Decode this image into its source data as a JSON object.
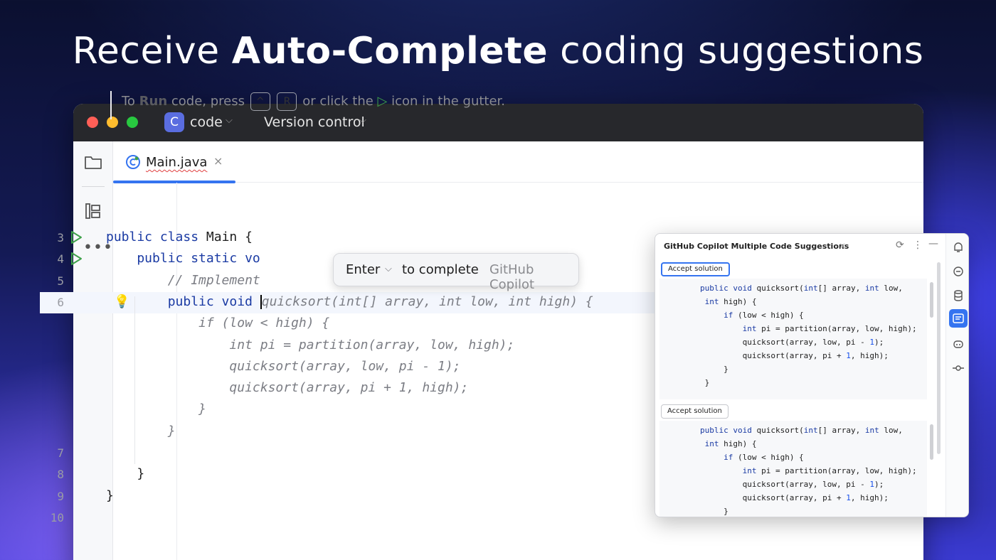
{
  "headline": {
    "pre": "Receive ",
    "bold": "Auto-Complete",
    "post": " coding suggestions"
  },
  "titlebar": {
    "project_badge": "C",
    "project_name": "code",
    "vcs_label": "Version control"
  },
  "sidebar": {
    "more": "•••"
  },
  "tab": {
    "label": "Main.java",
    "close": "×"
  },
  "hint": {
    "pre": "To ",
    "run_word": "Run",
    "mid": " code, press ",
    "key1": "^",
    "key2": "R",
    "post": " or click the ",
    "play": "▷",
    "tail": " icon in the gutter."
  },
  "editor": {
    "lines": [
      {
        "num": "3",
        "run": true,
        "segments": [
          {
            "t": "public class ",
            "c": "kw"
          },
          {
            "t": "Main {",
            "c": ""
          }
        ]
      },
      {
        "num": "4",
        "run": true,
        "segments": [
          {
            "t": "    public static ",
            "c": "kw"
          },
          {
            "t": "vo",
            "c": "kw"
          }
        ]
      },
      {
        "num": "5",
        "segments": [
          {
            "t": "        // Implement",
            "c": "sugg"
          }
        ]
      },
      {
        "num": "6",
        "current": true,
        "segments": [
          {
            "t": "        public void ",
            "c": "kw"
          }
        ],
        "suggestion": "quicksort(int[] array, int low, int high) {"
      },
      {
        "num": "",
        "segments": [
          {
            "t": "            if (low < high) {",
            "c": "sugg"
          }
        ]
      },
      {
        "num": "",
        "segments": [
          {
            "t": "                int pi = partition(array, low, high);",
            "c": "sugg"
          }
        ]
      },
      {
        "num": "",
        "segments": [
          {
            "t": "                quicksort(array, low, pi - 1);",
            "c": "sugg"
          }
        ]
      },
      {
        "num": "",
        "segments": [
          {
            "t": "                quicksort(array, pi + 1, high);",
            "c": "sugg"
          }
        ]
      },
      {
        "num": "",
        "segments": [
          {
            "t": "            }",
            "c": "sugg"
          }
        ]
      },
      {
        "num": "",
        "segments": [
          {
            "t": "        }",
            "c": "sugg"
          }
        ]
      },
      {
        "num": "7",
        "segments": [
          {
            "t": "",
            "c": ""
          }
        ]
      },
      {
        "num": "8",
        "segments": [
          {
            "t": "    }",
            "c": ""
          }
        ]
      },
      {
        "num": "9",
        "segments": [
          {
            "t": "}",
            "c": ""
          }
        ]
      },
      {
        "num": "10",
        "segments": [
          {
            "t": "",
            "c": ""
          }
        ]
      }
    ]
  },
  "completion": {
    "key": "Enter",
    "action": "to complete",
    "source": "GitHub Copilot"
  },
  "copilot": {
    "title": "GitHub Copilot Multiple Code Suggestions",
    "close": "×",
    "solutions": [
      {
        "accept_label": "Accept solution",
        "focused": true,
        "code": [
          "        public void quicksort(int[] array, int low,",
          "         int high) {",
          "             if (low < high) {",
          "                 int pi = partition(array, low, high);",
          "                 quicksort(array, low, pi - 1);",
          "                 quicksort(array, pi + 1, high);",
          "             }",
          "         }"
        ]
      },
      {
        "accept_label": "Accept solution",
        "focused": false,
        "code": [
          "        public void quicksort(int[] array, int low,",
          "         int high) {",
          "             if (low < high) {",
          "                 int pi = partition(array, low, high);",
          "                 quicksort(array, low, pi - 1);",
          "                 quicksort(array, pi + 1, high);",
          "             }"
        ]
      }
    ]
  },
  "colors": {
    "accent": "#3574f0",
    "keyword": "#1a3aa3",
    "suggestion": "#7b7d84",
    "run_green": "#3fa14a"
  },
  "icons": {
    "sidebar": [
      "folder-icon",
      "structure-icon",
      "more-icon"
    ],
    "rail": [
      "notifications-icon",
      "copilot-chat-icon",
      "database-icon",
      "copilot-suggestions-icon",
      "copilot-icon",
      "commit-icon"
    ]
  }
}
